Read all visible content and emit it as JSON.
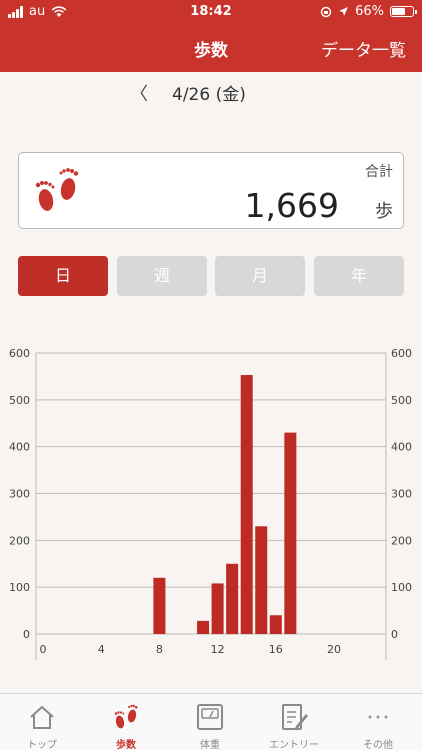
{
  "status_bar": {
    "carrier": "au",
    "time": "18:42",
    "battery": "66%",
    "battery_level": 0.66
  },
  "nav": {
    "title": "歩数",
    "right_button": "データ一覧"
  },
  "date_nav": {
    "prev_glyph": "〈",
    "date": "4/26 (金)"
  },
  "total": {
    "label": "合計",
    "value": "1,669",
    "unit": "歩"
  },
  "period_tabs": [
    {
      "label": "日",
      "active": true
    },
    {
      "label": "週",
      "active": false
    },
    {
      "label": "月",
      "active": false
    },
    {
      "label": "年",
      "active": false
    }
  ],
  "colors": {
    "accent": "#c8332b",
    "bar": "#be2a24",
    "inactive_tab": "#d8d8d8"
  },
  "chart_data": {
    "type": "bar",
    "x": [
      0,
      1,
      2,
      3,
      4,
      5,
      6,
      7,
      8,
      9,
      10,
      11,
      12,
      13,
      14,
      15,
      16,
      17,
      18,
      19,
      20,
      21,
      22,
      23
    ],
    "values": [
      0,
      0,
      0,
      0,
      0,
      0,
      0,
      0,
      120,
      0,
      0,
      28,
      108,
      150,
      553,
      230,
      40,
      430,
      0,
      0,
      0,
      0,
      0,
      0
    ],
    "x_ticks": [
      "0",
      "4",
      "8",
      "12",
      "16",
      "20"
    ],
    "y_ticks": [
      "0",
      "100",
      "200",
      "300",
      "400",
      "500",
      "600"
    ],
    "ylim": [
      0,
      600
    ],
    "grid": true,
    "legend": "none"
  },
  "tabbar": [
    {
      "label": "トップ",
      "icon": "home-icon",
      "active": false
    },
    {
      "label": "歩数",
      "icon": "footprints-icon",
      "active": true
    },
    {
      "label": "体重",
      "icon": "scale-icon",
      "active": false
    },
    {
      "label": "エントリー",
      "icon": "edit-note-icon",
      "active": false
    },
    {
      "label": "その他",
      "icon": "more-dots-icon",
      "active": false
    }
  ]
}
